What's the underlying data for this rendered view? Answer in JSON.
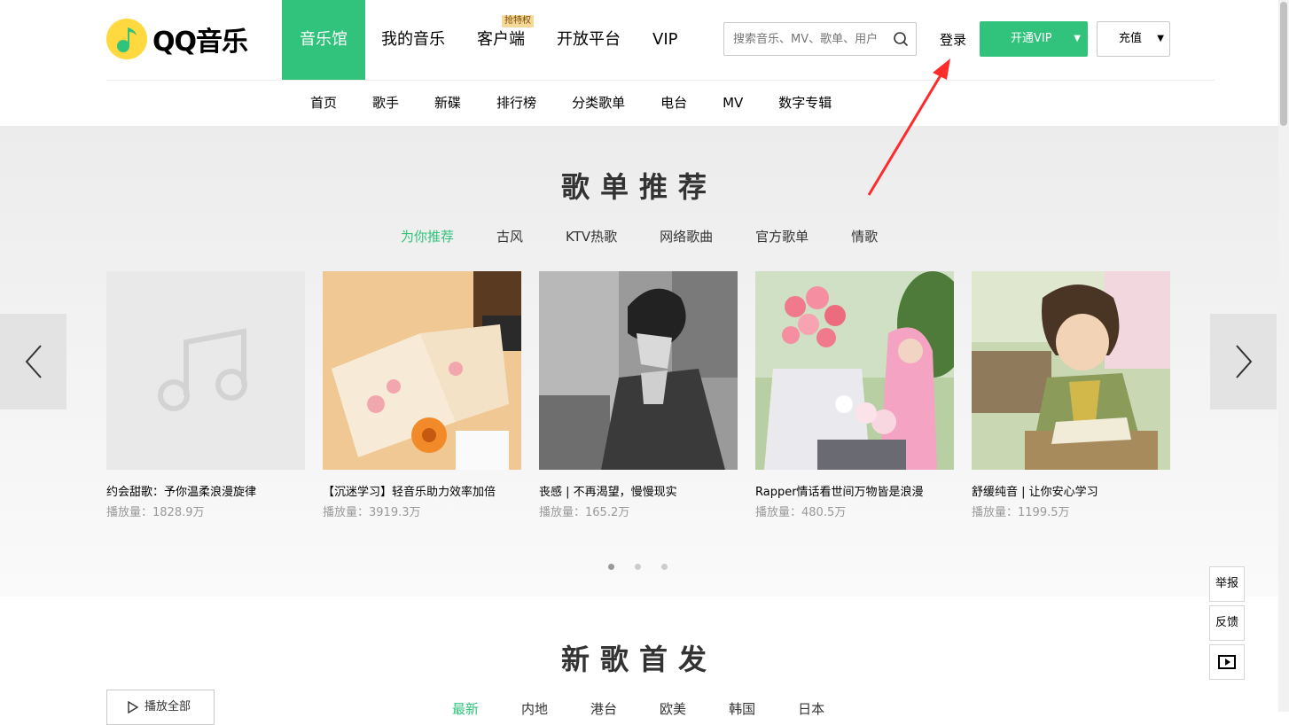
{
  "header": {
    "logo_text": "QQ音乐",
    "nav": [
      {
        "label": "音乐馆",
        "active": true
      },
      {
        "label": "我的音乐"
      },
      {
        "label": "客户端",
        "badge": "抢特权"
      },
      {
        "label": "开放平台"
      },
      {
        "label": "VIP"
      }
    ],
    "search_placeholder": "搜索音乐、MV、歌单、用户",
    "login_label": "登录",
    "vip_button": "开通VIP",
    "recharge_button": "充值",
    "subnav": [
      "首页",
      "歌手",
      "新碟",
      "排行榜",
      "分类歌单",
      "电台",
      "MV",
      "数字专辑"
    ]
  },
  "playlists": {
    "title": "歌单推荐",
    "tabs": [
      {
        "label": "为你推荐",
        "active": true
      },
      {
        "label": "古风"
      },
      {
        "label": "KTV热歌"
      },
      {
        "label": "网络歌曲"
      },
      {
        "label": "官方歌单"
      },
      {
        "label": "情歌"
      }
    ],
    "items": [
      {
        "title": "约会甜歌：予你温柔浪漫旋律",
        "plays": "播放量：1828.9万"
      },
      {
        "title": "【沉迷学习】轻音乐助力效率加倍",
        "plays": "播放量：3919.3万"
      },
      {
        "title": "丧感 | 不再渴望，慢慢现实",
        "plays": "播放量：165.2万"
      },
      {
        "title": "Rapper情话看世间万物皆是浪漫",
        "plays": "播放量：480.5万"
      },
      {
        "title": "舒缓纯音 | 让你安心学习",
        "plays": "播放量：1199.5万"
      }
    ],
    "page_count": 3,
    "current_page": 1
  },
  "new_songs": {
    "title": "新歌首发",
    "play_all": "播放全部",
    "tabs": [
      {
        "label": "最新",
        "active": true
      },
      {
        "label": "内地"
      },
      {
        "label": "港台"
      },
      {
        "label": "欧美"
      },
      {
        "label": "韩国"
      },
      {
        "label": "日本"
      }
    ]
  },
  "side_tools": {
    "report": "举报",
    "feedback": "反馈"
  },
  "colors": {
    "accent": "#31c27c",
    "annotation": "#ff2a2a"
  }
}
